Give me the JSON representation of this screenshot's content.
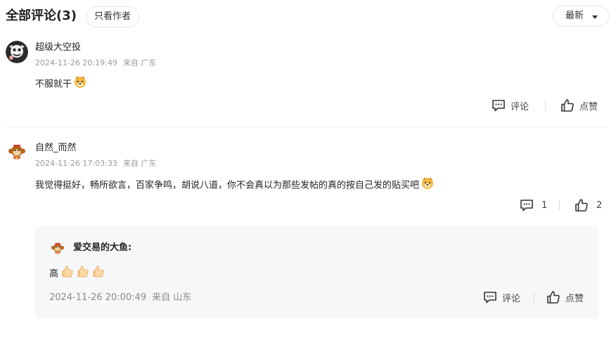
{
  "header": {
    "title": "全部评论(3)",
    "author_only_label": "只看作者",
    "sort_label": "最新"
  },
  "comments": [
    {
      "username": "超级大空投",
      "time": "2024-11-26 20:19:49",
      "location": "来自 广东",
      "text": "不服就干",
      "emoji": "dog-face-emoji",
      "comment_label": "评论",
      "like_label": "点赞",
      "avatar": "cartoon-character-avatar"
    },
    {
      "username": "自然_而然",
      "time": "2024-11-26 17:03:33",
      "location": "来自 广东",
      "text": "我觉得挺好，畅所欲言，百家争鸣，胡说八道，你不会真以为那些发帖的真的按自己发的贴买吧",
      "emoji": "dog-face-emoji",
      "comment_count": "1",
      "like_count": "2",
      "avatar": "monkey-avatar",
      "reply": {
        "username": "爱交易的大鱼:",
        "text": "高",
        "emojis": [
          "thumbs-up-emoji",
          "thumbs-up-emoji",
          "thumbs-up-emoji"
        ],
        "time": "2024-11-26 20:00:49",
        "location": "来自 山东",
        "comment_label": "评论",
        "like_label": "点赞",
        "avatar": "monkey-avatar"
      }
    }
  ],
  "colors": {
    "text_primary": "#222222",
    "text_secondary": "#999999",
    "reply_background": "#f6f7f8",
    "border": "#e6e6e6"
  }
}
